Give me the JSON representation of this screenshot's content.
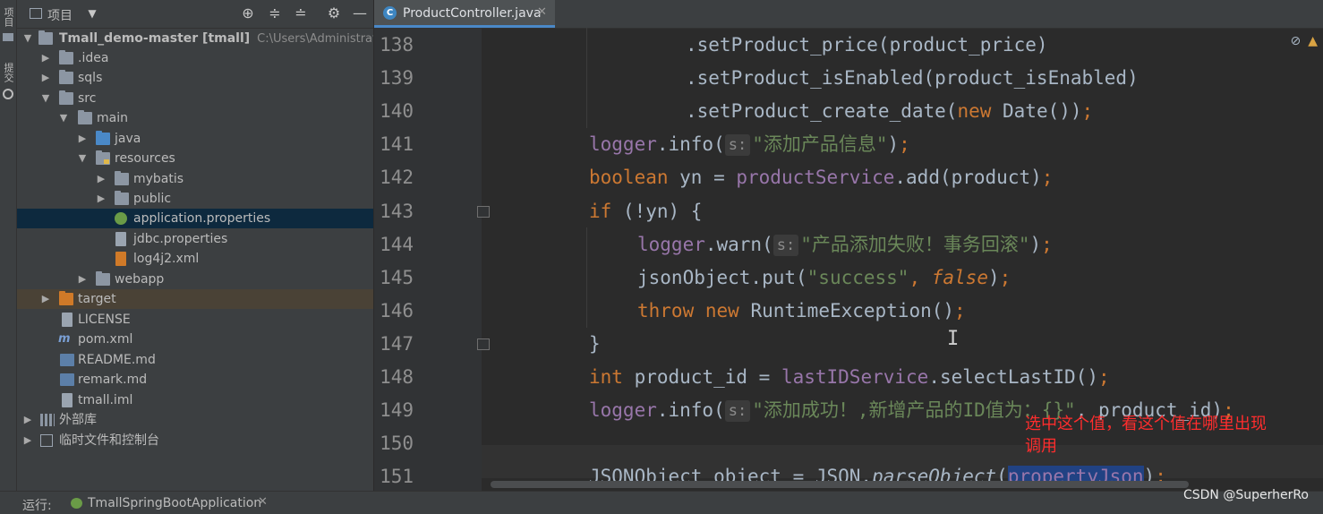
{
  "side_strip": {
    "project": "项目",
    "commit": "提交"
  },
  "project_panel": {
    "title": "项目",
    "tree": [
      {
        "label": "Tmall_demo-master [tmall]",
        "path": "C:\\Users\\Administrator\\De"
      },
      {
        "label": ".idea"
      },
      {
        "label": "sqls"
      },
      {
        "label": "src"
      },
      {
        "label": "main"
      },
      {
        "label": "java"
      },
      {
        "label": "resources"
      },
      {
        "label": "mybatis"
      },
      {
        "label": "public"
      },
      {
        "label": "application.properties"
      },
      {
        "label": "jdbc.properties"
      },
      {
        "label": "log4j2.xml"
      },
      {
        "label": "webapp"
      },
      {
        "label": "target"
      },
      {
        "label": "LICENSE"
      },
      {
        "label": "pom.xml"
      },
      {
        "label": "README.md"
      },
      {
        "label": "remark.md"
      },
      {
        "label": "tmall.iml"
      },
      {
        "label": "外部库"
      },
      {
        "label": "临时文件和控制台"
      }
    ]
  },
  "editor": {
    "tab": "ProductController.java",
    "lines": [
      {
        "n": "138"
      },
      {
        "n": "139"
      },
      {
        "n": "140"
      },
      {
        "n": "141"
      },
      {
        "n": "142"
      },
      {
        "n": "143"
      },
      {
        "n": "144"
      },
      {
        "n": "145"
      },
      {
        "n": "146"
      },
      {
        "n": "147"
      },
      {
        "n": "148"
      },
      {
        "n": "149"
      },
      {
        "n": "150"
      },
      {
        "n": "151"
      }
    ],
    "code": {
      "l138_pre": ".setProduct_price(product_price)",
      "l139_pre": ".setProduct_isEnabled(product_isEnabled)",
      "l140_a": ".setProduct_create_date(",
      "l140_kw": "new",
      "l140_b": " Date())",
      "semi": ";",
      "logger": "logger",
      "info_open": ".info(",
      "warn_open": ".warn(",
      "hint_s": "s:",
      "l141_str": "\"添加产品信息\"",
      "close_paren": ")",
      "l142_kw": "boolean",
      "l142_a": " yn = ",
      "l142_fld": "productService",
      "l142_b": ".add(product)",
      "l143_kw": "if",
      "l143_a": " (!yn) {",
      "l144_str": "\"产品添加失败！事务回滚\"",
      "l145_a": "jsonObject.put(",
      "l145_str": "\"success\"",
      "l145_comma": ", ",
      "l145_kw": "false",
      "l146_kw1": "throw",
      "l146_kw2": "new",
      "l146_a": " RuntimeException()",
      "brace_close": "}",
      "l148_kw": "int",
      "l148_a": " product_id = ",
      "l148_fld": "lastIDService",
      "l148_b": ".selectLastID()",
      "l149_str": "\"添加成功！,新增产品的ID值为：{}\"",
      "l149_a": ", product_id)",
      "l151_a": "JSONObject object = JSON.",
      "l151_ital": "parseObject",
      "l151_b": "(",
      "l151_sel": "propertyJson",
      "l151_c": ")"
    },
    "annotation": "选中这个值，看这个值在哪里出现调用"
  },
  "bottom_bar": {
    "run_label": "运行:",
    "app_name": "TmallSpringBootApplication"
  },
  "watermark": "CSDN @SuperherRo"
}
